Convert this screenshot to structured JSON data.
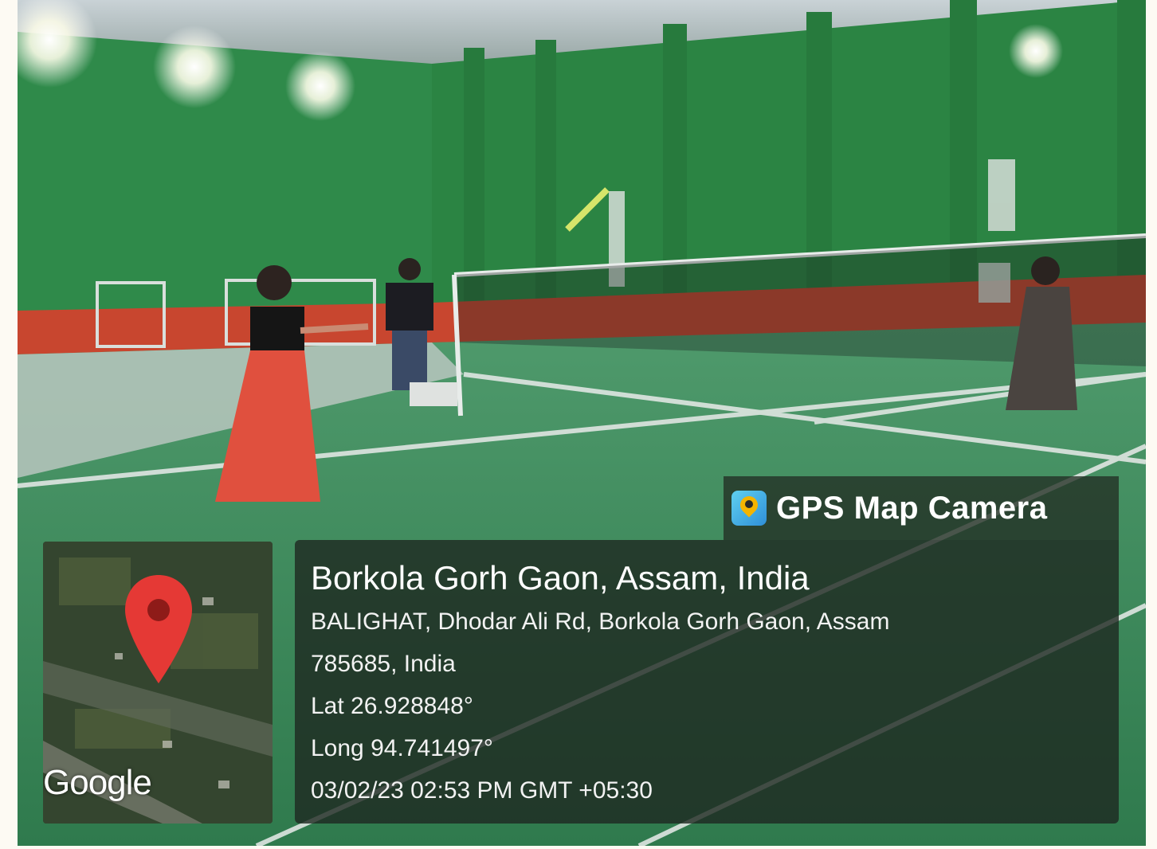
{
  "overlay": {
    "app_label": "GPS Map Camera",
    "app_icon": "gps-map-camera-icon",
    "place_title": "Borkola Gorh Gaon, Assam, India",
    "address_line1": "BALIGHAT, Dhodar Ali Rd, Borkola Gorh Gaon, Assam",
    "address_line2": "785685, India",
    "latitude": "Lat 26.928848°",
    "longitude": "Long 94.741497°",
    "timestamp": "03/02/23 02:53 PM GMT +05:30"
  },
  "map": {
    "provider_logo": "Google",
    "pin_icon": "map-pin-icon",
    "pin_color": "#e53935"
  },
  "photo": {
    "description_icon": "badminton-court-photo",
    "colors": {
      "wall": "#2f8a4a",
      "wall_band": "#c8462f",
      "court": "#3d8f5e",
      "court_edge": "#cfd6d2"
    }
  }
}
